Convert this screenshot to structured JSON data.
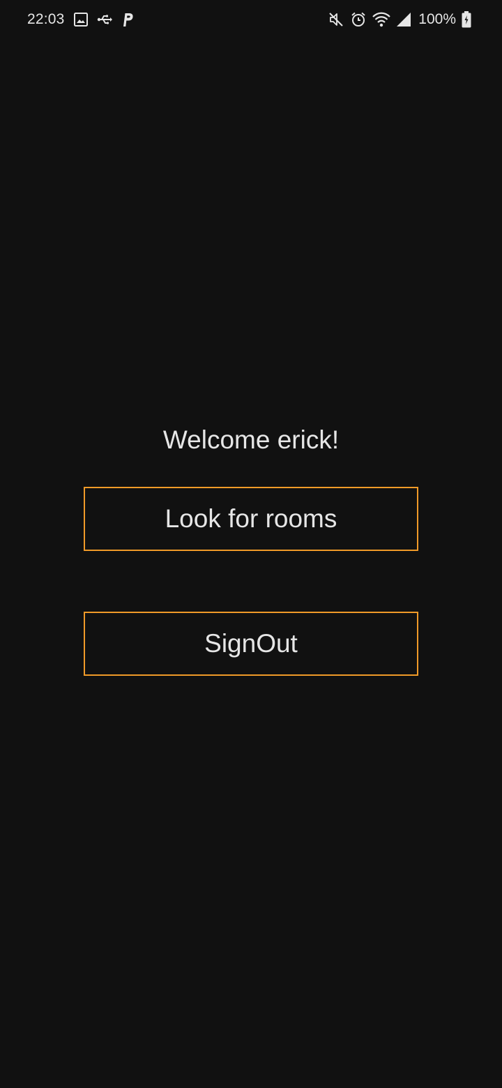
{
  "status_bar": {
    "time": "22:03",
    "battery_percent": "100%",
    "left_icons": [
      "image-icon",
      "usb-icon",
      "parking-icon"
    ],
    "right_icons": [
      "mute-icon",
      "alarm-icon",
      "wifi-icon",
      "signal-icon",
      "battery-icon"
    ]
  },
  "main": {
    "welcome_text": "Welcome erick!",
    "look_for_rooms_label": "Look for rooms",
    "signout_label": "SignOut"
  },
  "colors": {
    "background": "#111111",
    "text": "#e6e6e6",
    "button_border": "#f09a28"
  }
}
